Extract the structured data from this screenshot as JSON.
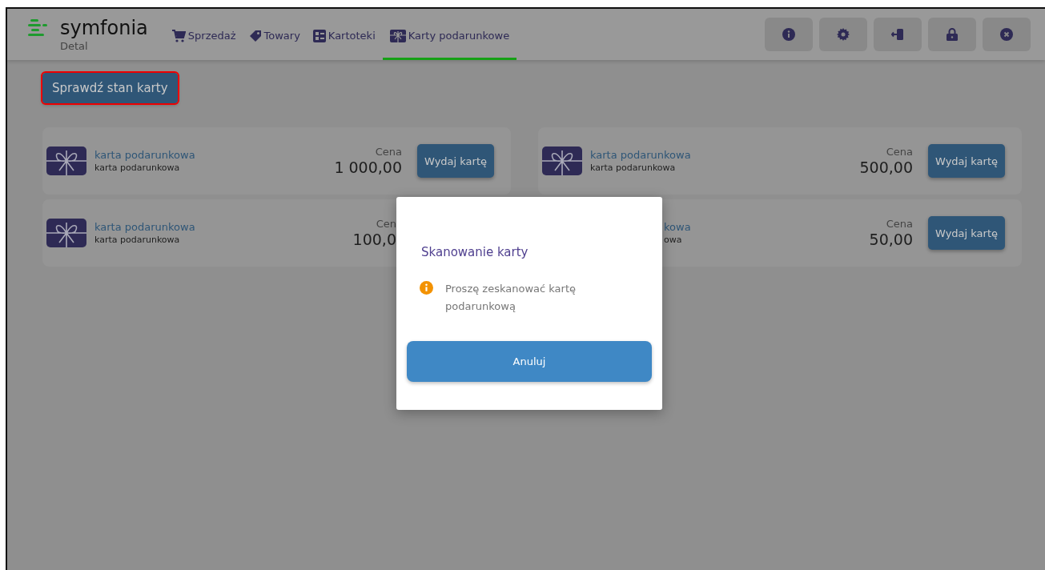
{
  "header": {
    "logo": "symfonia",
    "product": "Detal",
    "tabs": [
      {
        "label": "Sprzedaż",
        "selected": false
      },
      {
        "label": "Towary",
        "selected": false
      },
      {
        "label": "Kartoteki",
        "selected": false
      },
      {
        "label": "Karty podarunkowe",
        "selected": true
      }
    ]
  },
  "check_button": "Sprawdź stan karty",
  "cards": [
    {
      "kind": "full",
      "title": "karta podarunkowa",
      "subtitle": "karta podarunkowa",
      "price_label": "Cena",
      "price": "1 000,00",
      "button": "Wydaj kartę"
    },
    {
      "kind": "full",
      "title": "karta podarunkowa",
      "subtitle": "karta podarunkowa",
      "price_label": "Cena",
      "price": "500,00",
      "button": "Wydaj kartę"
    },
    {
      "kind": "right-covered",
      "title": "karta podarunkowa",
      "subtitle": "karta podarunkowa",
      "price_label": "Cen",
      "price": "100,0"
    },
    {
      "kind": "left-covered",
      "title": "kowa",
      "subtitle": "owa",
      "price_label": "Cena",
      "price": "50,00",
      "button": "Wydaj kartę"
    }
  ],
  "dialog": {
    "title": "Skanowanie karty",
    "message": "Proszę zeskanować kartę podarunkową",
    "button": "Anuluj"
  }
}
